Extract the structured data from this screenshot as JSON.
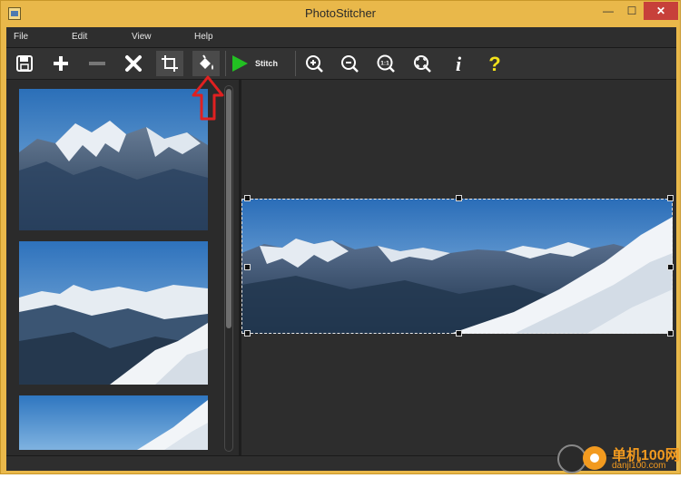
{
  "window": {
    "title": "PhotoStitcher",
    "controls": {
      "minimize": "—",
      "maximize": "☐",
      "close": "✕"
    }
  },
  "menu": {
    "items": [
      {
        "label": "File"
      },
      {
        "label": "Edit"
      },
      {
        "label": "View"
      },
      {
        "label": "Help"
      }
    ]
  },
  "toolbar": {
    "stitch_label": "Stitch",
    "zoom_actual_label": "1:1",
    "info_label": "i",
    "help_label": "?",
    "icons": [
      "save-icon",
      "add-icon",
      "remove-icon",
      "delete-icon",
      "crop-icon",
      "fill-bucket-icon",
      "play-icon",
      "zoom-in-icon",
      "zoom-out-icon",
      "zoom-actual-icon",
      "zoom-fit-icon",
      "info-icon",
      "help-icon"
    ],
    "colors": {
      "stitch": "#22c022",
      "help": "#f3e21b",
      "annotation_arrow": "#e02020"
    }
  },
  "watermark": {
    "text": "单机100网",
    "sub": "danji100.com"
  }
}
